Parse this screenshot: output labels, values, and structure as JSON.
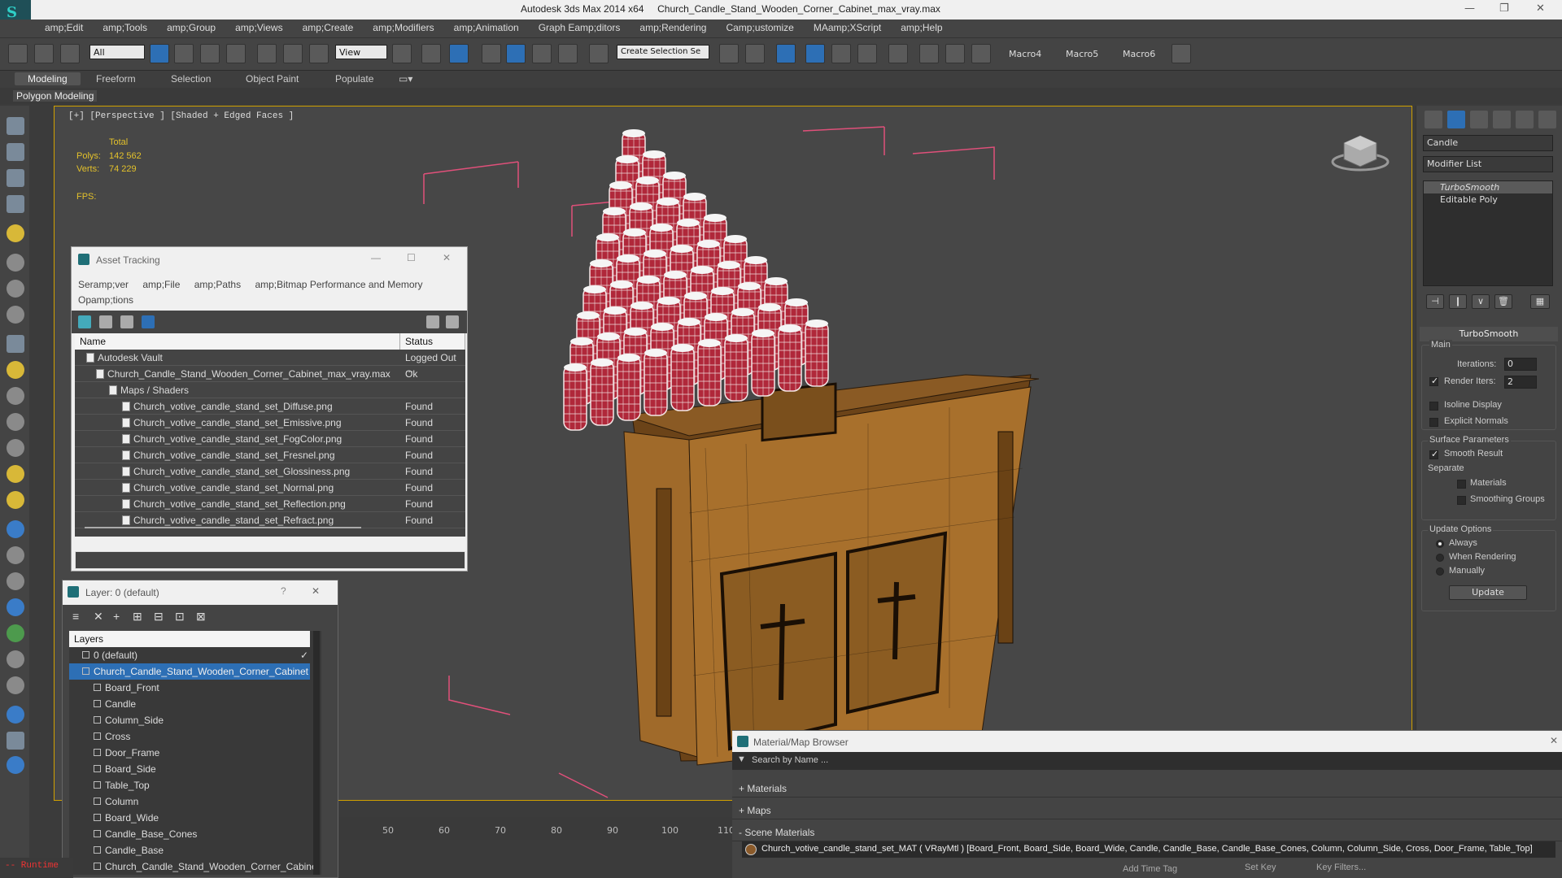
{
  "titlebar": {
    "app": "Autodesk 3ds Max  2014 x64",
    "file": "Church_Candle_Stand_Wooden_Corner_Cabinet_max_vray.max"
  },
  "menu": [
    "amp;Edit",
    "amp;Tools",
    "amp;Group",
    "amp;Views",
    "amp;Create",
    "amp;Modifiers",
    "amp;Animation",
    "Graph Eamp;ditors",
    "amp;Rendering",
    "Camp;ustomize",
    "MAamp;XScript",
    "amp;Help"
  ],
  "toolbar": {
    "filter_value": "All",
    "refcoord_value": "View",
    "selection_set_placeholder": "Create Selection Se",
    "macros": [
      "Macro4",
      "Macro5",
      "Macro6"
    ]
  },
  "ribbon": {
    "tabs": [
      "Modeling",
      "Freeform",
      "Selection",
      "Object Paint",
      "Populate"
    ],
    "sub": "Polygon Modeling"
  },
  "viewport": {
    "label": "[+] [Perspective ] [Shaded + Edged Faces ]",
    "stats": {
      "total_label": "Total",
      "polys_label": "Polys:",
      "polys": "142 562",
      "verts_label": "Verts:",
      "verts": "74 229",
      "fps_label": "FPS:"
    }
  },
  "timeline": {
    "ticks": [
      "50",
      "60",
      "70",
      "80",
      "90",
      "100",
      "110"
    ]
  },
  "right_panel": {
    "object_name": "Candle",
    "modifier_list_label": "Modifier List",
    "stack": [
      "TurboSmooth",
      "Editable Poly"
    ],
    "turbosmooth": {
      "title": "TurboSmooth",
      "main_label": "Main",
      "iterations_label": "Iterations:",
      "iterations": "0",
      "render_iters_label": "Render Iters:",
      "render_iters": "2",
      "isoline_label": "Isoline Display",
      "explicit_label": "Explicit Normals",
      "surface_label": "Surface Parameters",
      "smooth_label": "Smooth Result",
      "separate_label": "Separate",
      "materials_label": "Materials",
      "smoothing_groups_label": "Smoothing Groups",
      "update_label": "Update Options",
      "always_label": "Always",
      "when_rendering_label": "When Rendering",
      "manually_label": "Manually",
      "update_button": "Update"
    }
  },
  "asset_tracking": {
    "title": "Asset Tracking",
    "menu": [
      "Seramp;ver",
      "amp;File",
      "amp;Paths",
      "amp;Bitmap Performance and Memory",
      "Opamp;tions"
    ],
    "col_name": "Name",
    "col_status": "Status",
    "rows": [
      {
        "name": "Autodesk Vault",
        "status": "Logged Out ..."
      },
      {
        "name": "Church_Candle_Stand_Wooden_Corner_Cabinet_max_vray.max",
        "status": "Ok"
      },
      {
        "name": "Maps / Shaders",
        "status": ""
      },
      {
        "name": "Church_votive_candle_stand_set_Diffuse.png",
        "status": "Found"
      },
      {
        "name": "Church_votive_candle_stand_set_Emissive.png",
        "status": "Found"
      },
      {
        "name": "Church_votive_candle_stand_set_FogColor.png",
        "status": "Found"
      },
      {
        "name": "Church_votive_candle_stand_set_Fresnel.png",
        "status": "Found"
      },
      {
        "name": "Church_votive_candle_stand_set_Glossiness.png",
        "status": "Found"
      },
      {
        "name": "Church_votive_candle_stand_set_Normal.png",
        "status": "Found"
      },
      {
        "name": "Church_votive_candle_stand_set_Reflection.png",
        "status": "Found"
      },
      {
        "name": "Church_votive_candle_stand_set_Refract.png",
        "status": "Found"
      }
    ]
  },
  "layer_window": {
    "title": "Layer: 0 (default)",
    "help": "?",
    "header": "Layers",
    "items": [
      "0 (default)",
      "Church_Candle_Stand_Wooden_Corner_Cabinet",
      "Board_Front",
      "Candle",
      "Column_Side",
      "Cross",
      "Door_Frame",
      "Board_Side",
      "Table_Top",
      "Column",
      "Board_Wide",
      "Candle_Base_Cones",
      "Candle_Base",
      "Church_Candle_Stand_Wooden_Corner_Cabine"
    ]
  },
  "material_browser": {
    "title": "Material/Map Browser",
    "search_placeholder": "Search by Name ...",
    "groups": [
      "+ Materials",
      "+ Maps",
      "- Scene Materials"
    ],
    "scene_material": "Church_votive_candle_stand_set_MAT ( VRayMtl ) [Board_Front, Board_Side, Board_Wide, Candle, Candle_Base, Candle_Base_Cones, Column, Column_Side, Cross, Door_Frame, Table_Top]"
  },
  "statusbar": {
    "maxscript": "-- Runtime",
    "add_time_tag": "Add Time Tag",
    "set_key": "Set Key",
    "key_filters": "Key Filters..."
  }
}
